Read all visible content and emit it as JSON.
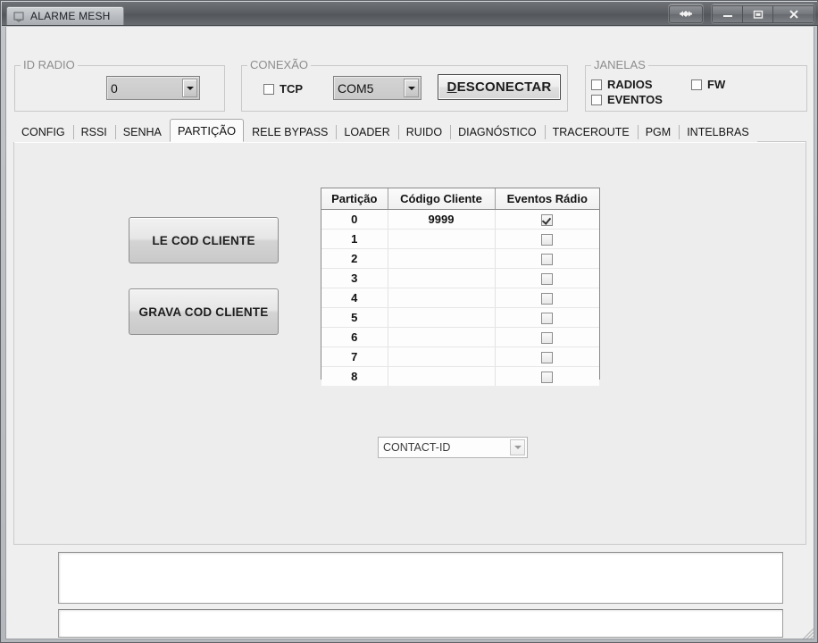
{
  "window": {
    "title": "ALARME MESH",
    "icon": "app-icon",
    "controls": {
      "restore_arrows": "restore-arrows-icon",
      "minimize": "minimize-icon",
      "maximize": "maximize-icon",
      "close": "close-icon"
    }
  },
  "toolbar": {
    "id_radio": {
      "legend": "ID RADIO",
      "value": "0",
      "options": [
        "0"
      ]
    },
    "conexao": {
      "legend": "CONEXÃO",
      "tcp_label": "TCP",
      "tcp_checked": false,
      "port_value": "COM5",
      "port_options": [
        "COM5"
      ],
      "disconnect_accel": "D",
      "disconnect_rest": "ESCONECTAR"
    },
    "janelas": {
      "legend": "JANELAS",
      "radios_label": "RADIOS",
      "radios_checked": false,
      "eventos_label": "EVENTOS",
      "eventos_checked": false,
      "fw_label": "FW",
      "fw_checked": false
    }
  },
  "tabs": [
    {
      "label": "CONFIG",
      "active": false
    },
    {
      "label": "RSSI",
      "active": false
    },
    {
      "label": "SENHA",
      "active": false
    },
    {
      "label": "PARTIÇÃO",
      "active": true
    },
    {
      "label": "RELE BYPASS",
      "active": false
    },
    {
      "label": "LOADER",
      "active": false
    },
    {
      "label": "RUIDO",
      "active": false
    },
    {
      "label": "DIAGNÓSTICO",
      "active": false
    },
    {
      "label": "TRACEROUTE",
      "active": false
    },
    {
      "label": "PGM",
      "active": false
    },
    {
      "label": "INTELBRAS",
      "active": false
    }
  ],
  "panel": {
    "buttons": {
      "read_label": "LE COD CLIENTE",
      "write_label": "GRAVA COD CLIENTE"
    },
    "grid": {
      "columns": [
        "Partição",
        "Código Cliente",
        "Eventos Rádio"
      ],
      "rows": [
        {
          "particao": "0",
          "codigo": "9999",
          "eventos": true
        },
        {
          "particao": "1",
          "codigo": "",
          "eventos": false
        },
        {
          "particao": "2",
          "codigo": "",
          "eventos": false
        },
        {
          "particao": "3",
          "codigo": "",
          "eventos": false
        },
        {
          "particao": "4",
          "codigo": "",
          "eventos": false
        },
        {
          "particao": "5",
          "codigo": "",
          "eventos": false
        },
        {
          "particao": "6",
          "codigo": "",
          "eventos": false
        },
        {
          "particao": "7",
          "codigo": "",
          "eventos": false
        },
        {
          "particao": "8",
          "codigo": "",
          "eventos": false
        }
      ]
    },
    "protocol": {
      "value": "CONTACT-ID",
      "options": [
        "CONTACT-ID"
      ]
    }
  },
  "log": {
    "main_value": "",
    "sub_value": ""
  },
  "colors": {
    "window_bg": "#efefef",
    "titlebar": "#5b5e62",
    "panel_bg": "#ededed",
    "grid_bg": "#fdfdfd",
    "legend_text": "#8d8d8d"
  }
}
